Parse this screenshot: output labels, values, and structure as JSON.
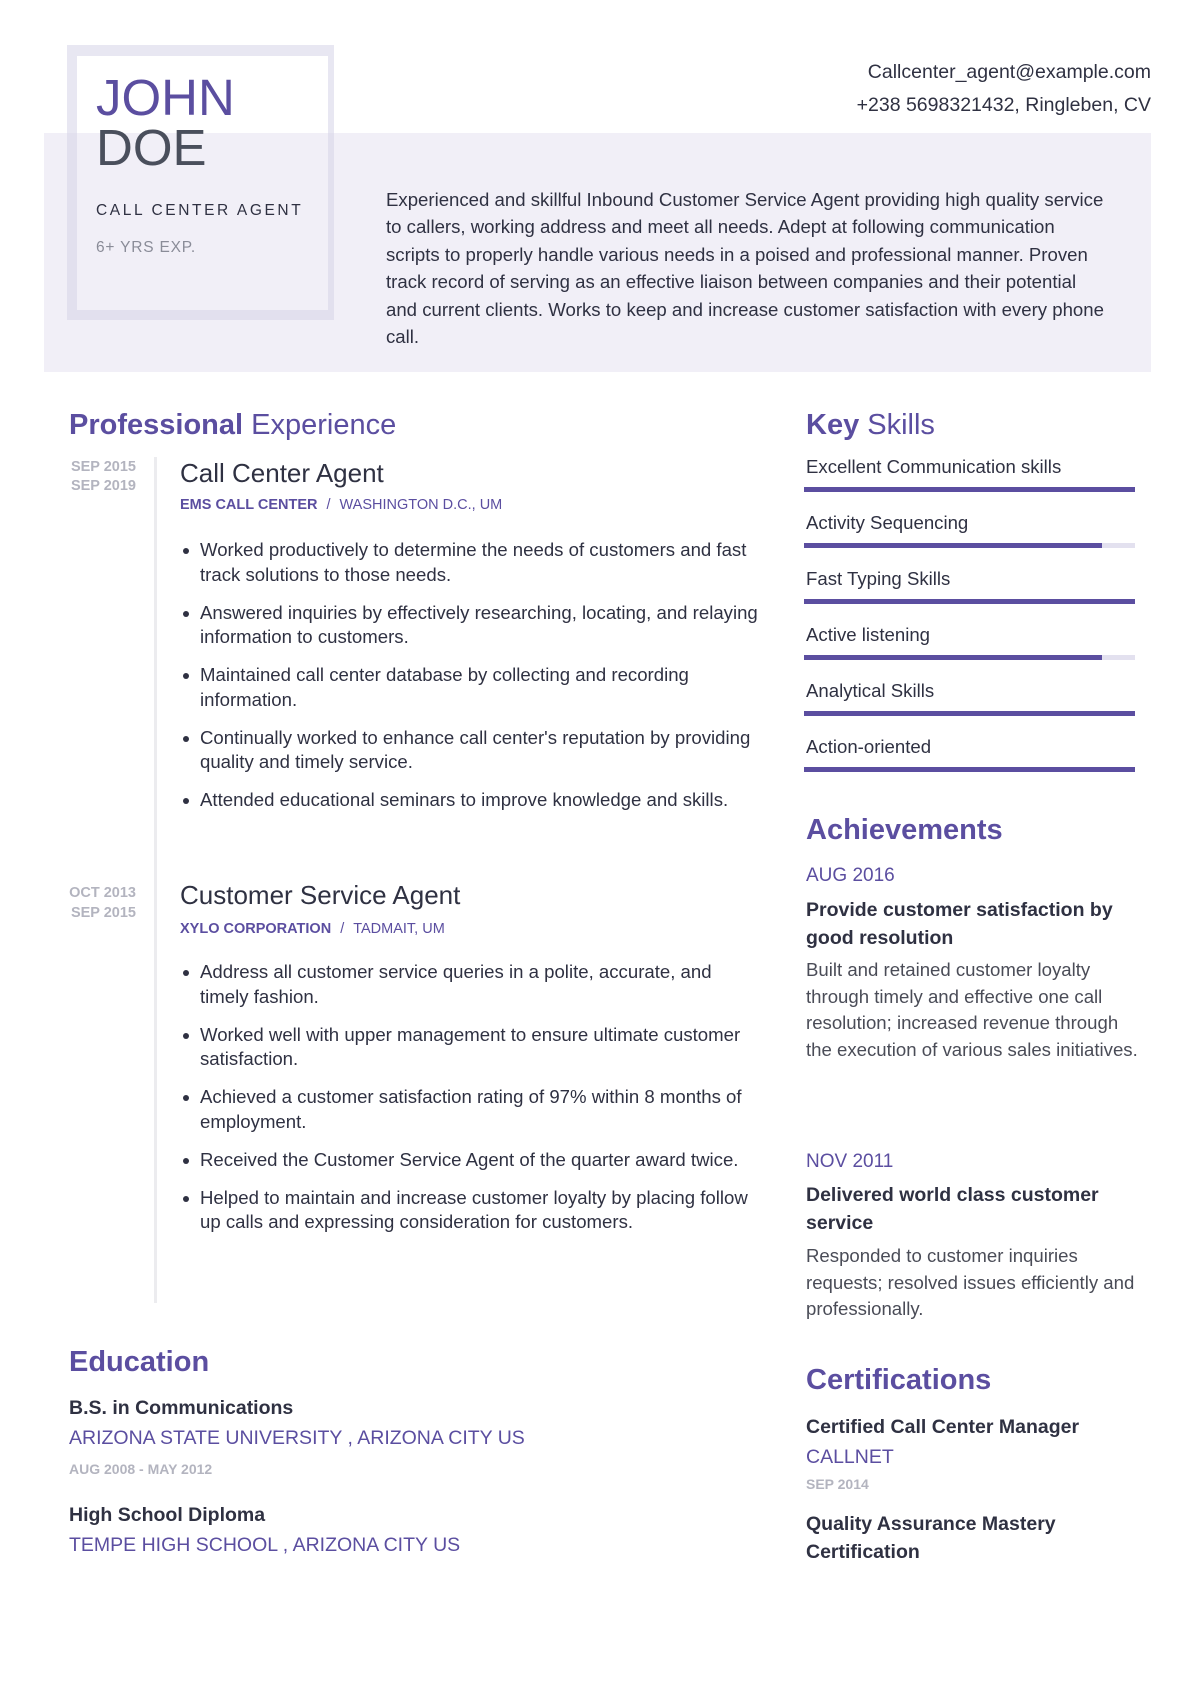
{
  "header": {
    "first_name": "JOHN",
    "last_name": "DOE",
    "role": "CALL CENTER AGENT",
    "experience": "6+ YRS EXP.",
    "email": "Callcenter_agent@example.com",
    "phone_location": "+238 5698321432, Ringleben, CV",
    "summary": "Experienced and skillful Inbound Customer Service Agent providing high quality service to callers, working address and meet all needs. Adept at following communication scripts to properly handle various needs in a poised and professional manner. Proven track record of serving as an effective liaison between companies and their potential and current clients. Works to keep and increase customer satisfaction with every phone call."
  },
  "experience": {
    "heading_bold": "Professional",
    "heading_rest": " Experience",
    "jobs": [
      {
        "start": "SEP 2015",
        "end": "SEP 2019",
        "title": "Call Center Agent",
        "company": "EMS CALL CENTER",
        "separator": "/",
        "location": "WASHINGTON D.C., UM",
        "bullets": [
          "Worked productively to determine the needs of customers and fast track solutions to those needs.",
          "Answered inquiries by effectively researching, locating, and relaying information to customers.",
          "Maintained call center database by collecting and recording information.",
          "Continually worked to enhance call center's reputation by providing quality and timely service.",
          "Attended educational seminars to improve knowledge and skills."
        ]
      },
      {
        "start": "OCT 2013",
        "end": "SEP 2015",
        "title": "Customer Service Agent",
        "company": "XYLO CORPORATION",
        "separator": "/",
        "location": "TADMAIT, UM",
        "bullets": [
          "Address all customer service queries in a polite, accurate, and timely fashion.",
          "Worked well with upper management to ensure ultimate customer satisfaction.",
          "Achieved a customer satisfaction rating of 97% within 8 months of employment.",
          "Received the Customer Service Agent of the quarter award twice.",
          "Helped to maintain and increase customer loyalty by placing follow up calls and expressing consideration for customers."
        ]
      }
    ]
  },
  "skills": {
    "heading_bold": "Key",
    "heading_rest": " Skills",
    "items": [
      {
        "label": "Excellent Communication skills",
        "level": 1.0
      },
      {
        "label": "Activity Sequencing",
        "level": 0.9
      },
      {
        "label": "Fast Typing Skills",
        "level": 1.0
      },
      {
        "label": "Active listening",
        "level": 0.9
      },
      {
        "label": "Analytical Skills",
        "level": 1.0
      },
      {
        "label": "Action-oriented",
        "level": 1.0
      }
    ]
  },
  "achievements": {
    "heading": "Achievements",
    "items": [
      {
        "date": "AUG 2016",
        "title": "Provide customer satisfaction by good resolution",
        "description": "Built and retained customer loyalty through timely and effective one call resolution; increased revenue through the execution of various sales initiatives."
      },
      {
        "date": "NOV 2011",
        "title": "Delivered world class customer service",
        "description": "Responded to customer inquiries requests; resolved issues efficiently and professionally."
      }
    ]
  },
  "education": {
    "heading": "Education",
    "items": [
      {
        "degree": "B.S. in Communications",
        "school": "ARIZONA STATE UNIVERSITY , ARIZONA CITY US",
        "dates": "AUG 2008 - MAY 2012"
      },
      {
        "degree": "High School Diploma",
        "school": "TEMPE HIGH SCHOOL , ARIZONA CITY US"
      }
    ]
  },
  "certifications": {
    "heading": "Certifications",
    "items": [
      {
        "title": "Certified Call Center Manager",
        "org": "CALLNET",
        "date": "SEP 2014"
      },
      {
        "title": "Quality Assurance Mastery Certification"
      }
    ]
  },
  "colors": {
    "accent": "#5b4ea0",
    "text": "#2f3142",
    "muted": "#b3b4bf",
    "band": "#f1eff7"
  }
}
